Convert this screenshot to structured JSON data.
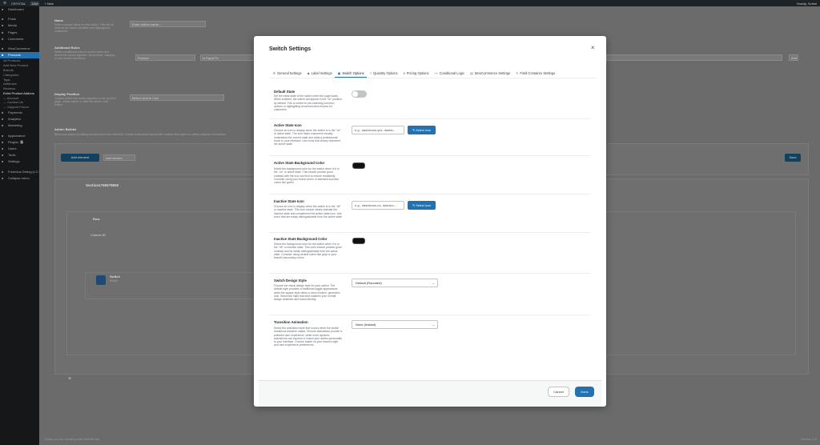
{
  "adminbar": {
    "site": "CRYSTAL",
    "badge": "Live",
    "new": "+ New",
    "howdy": "Howdy, Sohini"
  },
  "sidebar": {
    "items": [
      {
        "label": "Dashboard",
        "icon": "dashboard-icon"
      },
      {
        "label": "Posts",
        "icon": "pin-icon"
      },
      {
        "label": "Media",
        "icon": "media-icon"
      },
      {
        "label": "Pages",
        "icon": "page-icon"
      },
      {
        "label": "Comments",
        "icon": "comment-icon"
      },
      {
        "label": "WooCommerce",
        "icon": "woo-icon"
      },
      {
        "label": "Products",
        "icon": "archive-icon"
      }
    ],
    "sub": [
      "All Products",
      "Add New Product",
      "Brands",
      "Categories",
      "Tags",
      "Attributes",
      "Reviews",
      "Extra Product Addons",
      "— Account",
      "— Contact Us",
      "— Support Forum"
    ],
    "items2": [
      {
        "label": "Payments",
        "icon": "payment-icon"
      },
      {
        "label": "Analytics",
        "icon": "chart-icon"
      },
      {
        "label": "Marketing",
        "icon": "megaphone-icon"
      },
      {
        "label": "Appearance",
        "icon": "brush-icon"
      },
      {
        "label": "Plugins",
        "icon": "plugin-icon",
        "count": "3"
      },
      {
        "label": "Users",
        "icon": "users-icon"
      },
      {
        "label": "Tools",
        "icon": "tools-icon"
      },
      {
        "label": "Settings",
        "icon": "settings-icon"
      },
      {
        "label": "Freemius Debug [v.2.13.0]",
        "icon": "bug-icon"
      },
      {
        "label": "Collapse menu",
        "icon": "collapse-icon"
      }
    ]
  },
  "background": {
    "name_title": "Name",
    "name_desc": "Enter a unique name for this addon. This will be used as the addon identifier and displayed to customers.",
    "name_placeholder": "Enter addon name...",
    "rules_title": "Additional Rules",
    "rules_desc": "Define conditional rules to control when and where this addon appears. Set product, category, or user-based conditions.",
    "rule_field": "Product",
    "rule_operator": "Is Equal To",
    "add_label": "Add",
    "position_title": "Display Position",
    "position_desc": "Choose where this addon appears on the product page - either before or after the Add to Cart button.",
    "position_value": "Before Add to Cart",
    "builder_title": "Addon Builder",
    "builder_desc": "Build your addon by adding sections and form elements. Create a structured layout with multiple field types to collect customer information.",
    "add_element": "Add element",
    "add_section": "Add section",
    "save": "Save",
    "section_name": "Section1766578550",
    "row": "Row",
    "column": "Column ID",
    "element_title": "Switch",
    "element_sub": "Switch"
  },
  "footer": {
    "credit": "Thank you for creating with WordPress.",
    "version": "Version 6.8"
  },
  "modal": {
    "title": "Switch Settings",
    "close": "×",
    "tabs": [
      {
        "label": "General Settings",
        "icon": "gear-icon",
        "glyph": "⚙"
      },
      {
        "label": "Label Settings",
        "icon": "tag-icon",
        "glyph": "◆"
      },
      {
        "label": "Switch Options",
        "icon": "toggle-icon",
        "glyph": "▣"
      },
      {
        "label": "Quantity Options",
        "icon": "list-icon",
        "glyph": "≡"
      },
      {
        "label": "Pricing Options",
        "icon": "price-icon",
        "glyph": "$"
      },
      {
        "label": "Conditional Logic",
        "icon": "logic-icon",
        "glyph": "⊶"
      },
      {
        "label": "WooCommerce Settings",
        "icon": "cart-icon",
        "glyph": "▤"
      },
      {
        "label": "Field Container Settings",
        "icon": "wrench-icon",
        "glyph": "✎"
      }
    ],
    "active_tab": 2,
    "default_state": {
      "title": "Default State",
      "desc": "Set the initial state of the switch when the page loads. When enabled, the switch will appear in the \"on\" position by default. This is useful for pre-selecting common options or highlighting recommended choices for customers.",
      "enabled": false
    },
    "active_icon": {
      "title": "Active State Icon",
      "desc": "Choose an icon to display when the switch is in the \"on\" or active state. The icon helps customers visually understand the current state and adds a professional touch to your interface. Use icons that clearly represent the active state.",
      "placeholder": "e.g., dashicons-yes, dashic...",
      "button": "Select Icon"
    },
    "active_bg": {
      "title": "Active State Background Color",
      "desc": "Select the background color for the switch when it is in the \"on\" or active state. This should provide good contrast with the icon and text to ensure readability. Consider using your brand colors or standard success colors like green.",
      "color": "#111111"
    },
    "inactive_icon": {
      "title": "Inactive State Icon",
      "desc": "Choose an icon to display when the switch is in the \"off\" or inactive state. This icon should clearly indicate the inactive state and complement the active state icon. Use icons that are easily distinguishable from the active state.",
      "placeholder": "e.g., dashicons-no, dashico...",
      "button": "Select Icon"
    },
    "inactive_bg": {
      "title": "Inactive State Background Color",
      "desc": "Select the background color for the switch when it is in the \"off\" or inactive state. This color should provide good contrast and be easily distinguishable from the active state. Consider using neutral colors like gray or your brand's secondary colors.",
      "color": "#111111"
    },
    "design": {
      "title": "Switch Design Style",
      "desc": "Choose the visual design style for your switch. The default style provides a traditional toggle appearance, while the square style offers a more modern, geometric look. Select the style that best matches your overall design aesthetic and brand identity.",
      "value": "Default (Rounded)"
    },
    "transition": {
      "title": "Transition Animation",
      "desc": "Select the animation style that occurs when the switch transitions between states. Smooth animations provide a polished user experience, while more dynamic animations can express or match your addon personality to your interface. Choose based on your brand's style and user experience preferences.",
      "value": "None (Instant)"
    },
    "cancel": "Cancel",
    "done": "Done"
  },
  "colors": {
    "accent": "#2271b1",
    "sidebar": "#151719",
    "adminbar": "#1d2327"
  }
}
